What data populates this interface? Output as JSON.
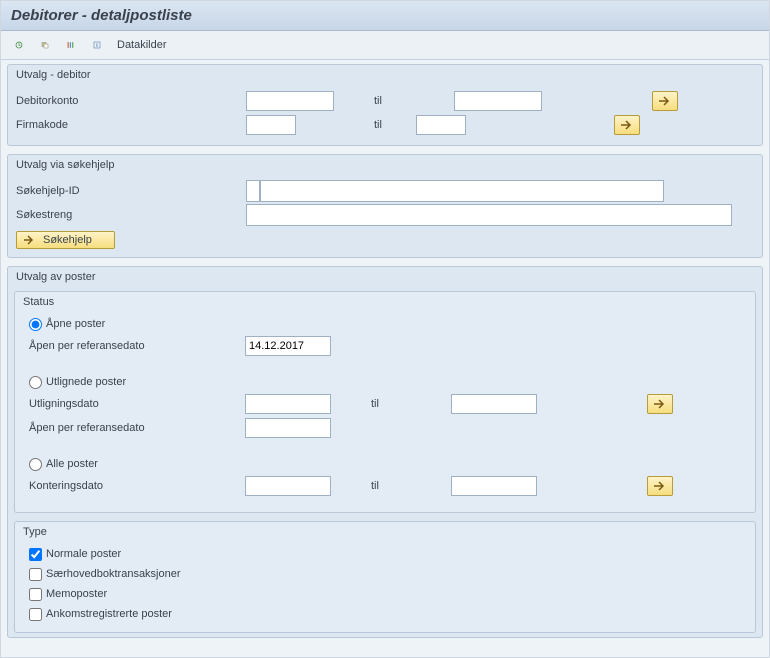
{
  "header": {
    "title": "Debitorer - detaljpostliste"
  },
  "toolbar": {
    "datakilder_label": "Datakilder"
  },
  "groups": {
    "debitor": {
      "title": "Utvalg - debitor",
      "rows": {
        "konto": {
          "label": "Debitorkonto",
          "til_label": "til"
        },
        "firma": {
          "label": "Firmakode",
          "til_label": "til"
        }
      }
    },
    "sokehjelp": {
      "title": "Utvalg via søkehjelp",
      "id_label": "Søkehjelp-ID",
      "streng_label": "Søkestreng",
      "btn_label": "Søkehjelp"
    },
    "poster": {
      "title": "Utvalg av poster",
      "status": {
        "title": "Status",
        "open": {
          "radio_label": "Åpne poster",
          "ref_label": "Åpen per referansedato",
          "ref_date": "14.12.2017"
        },
        "cleared": {
          "radio_label": "Utlignede poster",
          "utl_label": "Utligningsdato",
          "til_label": "til",
          "ref_label": "Åpen per referansedato"
        },
        "all": {
          "radio_label": "Alle poster",
          "kont_label": "Konteringsdato",
          "til_label": "til"
        }
      },
      "type": {
        "title": "Type",
        "normale": "Normale poster",
        "saer": "Særhovedboktransaksjoner",
        "memo": "Memoposter",
        "ankomst": "Ankomstregistrerte poster"
      }
    }
  }
}
